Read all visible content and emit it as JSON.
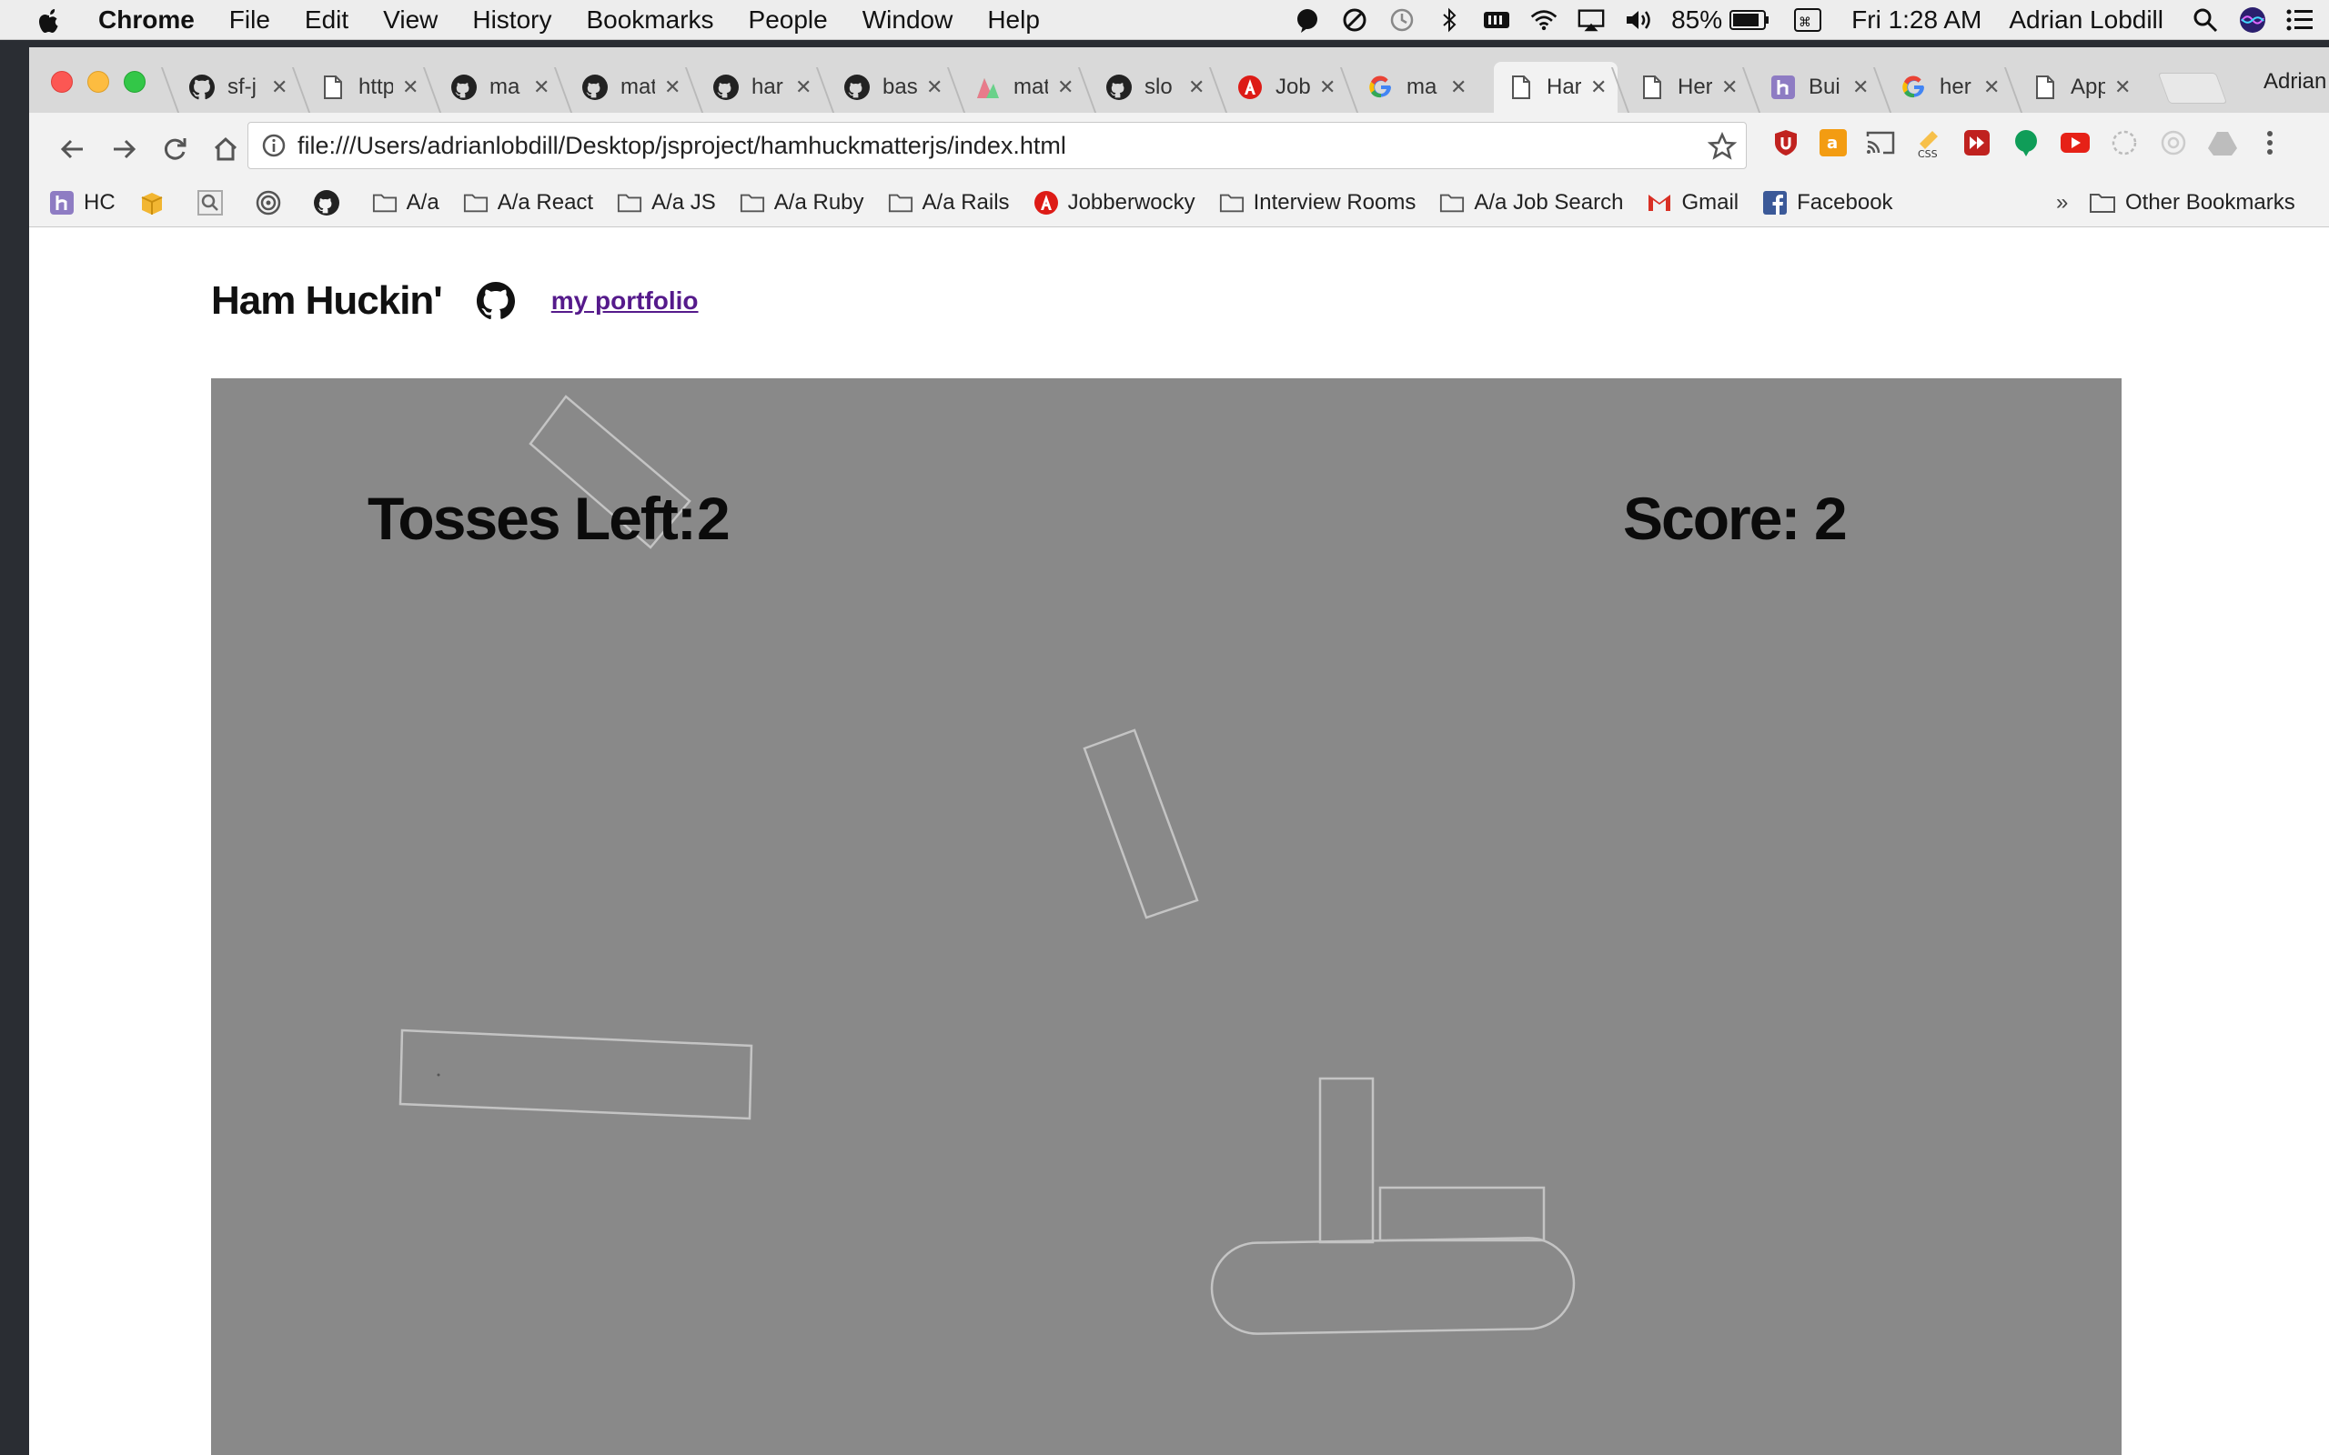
{
  "menubar": {
    "app": "Chrome",
    "menus": [
      "File",
      "Edit",
      "View",
      "History",
      "Bookmarks",
      "People",
      "Window",
      "Help"
    ],
    "battery": "85%",
    "clock": "Fri 1:28 AM",
    "user": "Adrian Lobdill"
  },
  "tabs": [
    {
      "icon": "github-icon",
      "title": "sf-j"
    },
    {
      "icon": "page-icon",
      "title": "http"
    },
    {
      "icon": "github-icon",
      "title": "ma"
    },
    {
      "icon": "github-icon",
      "title": "mat"
    },
    {
      "icon": "github-icon",
      "title": "har"
    },
    {
      "icon": "github-icon",
      "title": "bas"
    },
    {
      "icon": "chart-icon",
      "title": "mat"
    },
    {
      "icon": "github-icon",
      "title": "slo"
    },
    {
      "icon": "angular-icon",
      "title": "Job"
    },
    {
      "icon": "google-icon",
      "title": "ma"
    },
    {
      "icon": "page-icon",
      "title": "Har"
    },
    {
      "icon": "page-icon",
      "title": "Her"
    },
    {
      "icon": "heroku-icon",
      "title": "Bui"
    },
    {
      "icon": "google-icon",
      "title": "her"
    },
    {
      "icon": "page-icon",
      "title": "App"
    }
  ],
  "profile_name": "Adrian",
  "address_bar": {
    "url": "file:///Users/adrianlobdill/Desktop/jsproject/hamhuckmatterjs/index.html"
  },
  "bookmarks": [
    {
      "icon": "heroku-icon",
      "label": "HC"
    },
    {
      "icon": "box-icon",
      "label": ""
    },
    {
      "icon": "search-icon",
      "label": ""
    },
    {
      "icon": "swirl-icon",
      "label": ""
    },
    {
      "icon": "github-icon",
      "label": ""
    },
    {
      "icon": "folder-icon",
      "label": "A/a"
    },
    {
      "icon": "folder-icon",
      "label": "A/a React"
    },
    {
      "icon": "folder-icon",
      "label": "A/a JS"
    },
    {
      "icon": "folder-icon",
      "label": "A/a Ruby"
    },
    {
      "icon": "folder-icon",
      "label": "A/a Rails"
    },
    {
      "icon": "angular-icon",
      "label": "Jobberwocky"
    },
    {
      "icon": "folder-icon",
      "label": "Interview Rooms"
    },
    {
      "icon": "folder-icon",
      "label": "A/a Job Search"
    },
    {
      "icon": "gmail-icon",
      "label": "Gmail"
    },
    {
      "icon": "facebook-icon",
      "label": "Facebook"
    }
  ],
  "bookmarks_overflow": "»",
  "other_bookmarks": "Other Bookmarks",
  "site": {
    "title": "Ham Huckin'",
    "portfolio_link": "my portfolio"
  },
  "game": {
    "tosses_label": "Tosses Left:",
    "tosses_value": "2",
    "score_label": "Score:",
    "score_value": "2",
    "colors": {
      "background": "#898989",
      "outline": "#c4c4c4"
    }
  }
}
